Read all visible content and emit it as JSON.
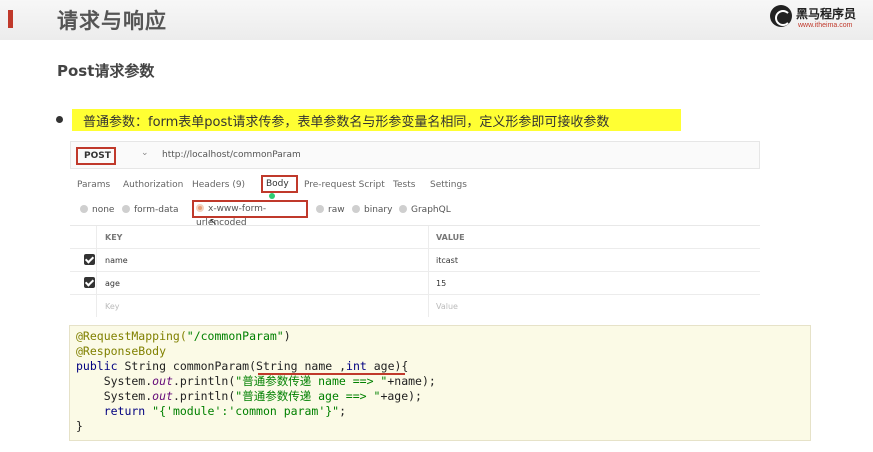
{
  "slide": {
    "title": "请求与响应",
    "subtitle": "Post请求参数",
    "description": "普通参数：form表单post请求传参，表单参数名与形参变量名相同，定义形参即可接收参数"
  },
  "logo": {
    "name": "黑马程序员",
    "url": "www.itheima.com"
  },
  "postman": {
    "method": "POST",
    "url": "http://localhost/commonParam",
    "tabs": [
      "Params",
      "Authorization",
      "Headers (9)",
      "Body",
      "Pre-request Script",
      "Tests",
      "Settings"
    ],
    "active_tab": "Body",
    "body_types": [
      "none",
      "form-data",
      "x-www-form-urlencoded",
      "raw",
      "binary",
      "GraphQL"
    ],
    "selected_body_type": "x-www-form-urlencoded",
    "table": {
      "headers": [
        "KEY",
        "VALUE"
      ],
      "rows": [
        {
          "key": "name",
          "value": "itcast",
          "checked": true
        },
        {
          "key": "age",
          "value": "15",
          "checked": true
        }
      ],
      "placeholder_key": "Key",
      "placeholder_value": "Value"
    }
  },
  "code": {
    "line1_ann": "@RequestMapping(",
    "line1_str": "\"/commonParam\"",
    "line1_end": ")",
    "line2": "@ResponseBody",
    "line3_kw": "public",
    "line3_rest": " String commonParam(String name ,",
    "line3_kw2": "int",
    "line3_end": " age){",
    "line4_a": "    System.",
    "line4_out": "out",
    "line4_b": ".println(",
    "line4_str": "\"普通参数传递 name ==> \"",
    "line4_c": "+name);",
    "line5_a": "    System.",
    "line5_out": "out",
    "line5_b": ".println(",
    "line5_str": "\"普通参数传递 age ==> \"",
    "line5_c": "+age);",
    "line6_kw": "    return",
    "line6_str": " \"{'module':'common param'}\"",
    "line6_end": ";",
    "line7": "}"
  },
  "colors": {
    "accent_red": "#c0392b",
    "highlight": "#ffff33",
    "code_bg": "#fbfae6"
  }
}
